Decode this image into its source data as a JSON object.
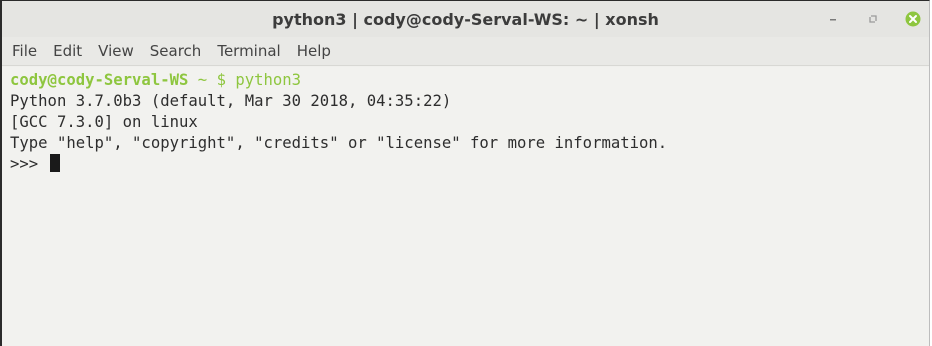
{
  "window": {
    "title": "python3 | cody@cody-Serval-WS: ~ | xonsh",
    "controls": [
      "minimize-icon",
      "maximize-icon",
      "close-icon"
    ],
    "close_color": "#8ec63f"
  },
  "menu": {
    "items": [
      "File",
      "Edit",
      "View",
      "Search",
      "Terminal",
      "Help"
    ]
  },
  "terminal": {
    "prompt_user": "cody@cody-Serval-WS",
    "prompt_path": " ~ ",
    "prompt_symbol": "$",
    "prompt_command": " python3",
    "lines": [
      "Python 3.7.0b3 (default, Mar 30 2018, 04:35:22)",
      "[GCC 7.3.0] on linux",
      "Type \"help\", \"copyright\", \"credits\" or \"license\" for more information."
    ],
    "repl_prompt": ">>> "
  }
}
